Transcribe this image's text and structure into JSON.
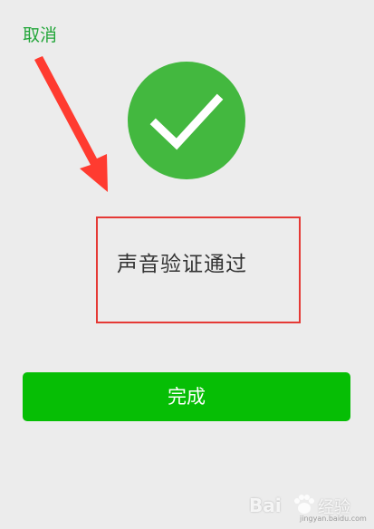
{
  "header": {
    "cancel_label": "取消"
  },
  "status": {
    "icon": "checkmark-icon",
    "success_color": "#43b83f",
    "message": "声音验证通过"
  },
  "actions": {
    "done_label": "完成",
    "done_color": "#06be05"
  },
  "annotation": {
    "arrow_color": "#ff3b30",
    "box_color": "#e53935"
  },
  "watermark": {
    "brand": "Bai",
    "brand_suffix": "经验",
    "url": "jingyan.baidu.com"
  }
}
